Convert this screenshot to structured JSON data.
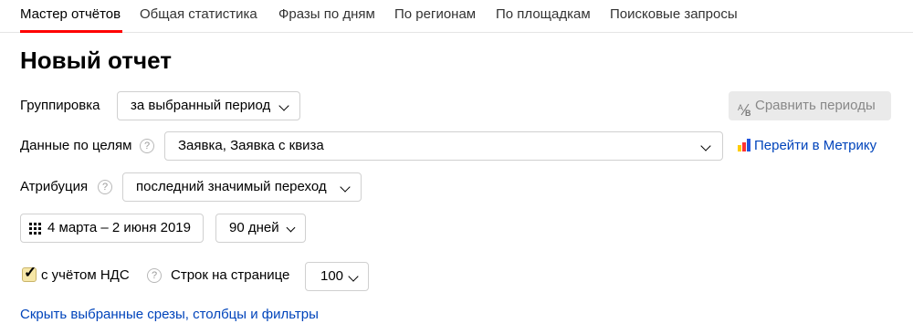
{
  "tabs": [
    {
      "label": "Мастер отчётов",
      "active": true
    },
    {
      "label": "Общая статистика"
    },
    {
      "label": "Фразы по дням"
    },
    {
      "label": "По регионам"
    },
    {
      "label": "По площадкам"
    },
    {
      "label": "Поисковые запросы"
    }
  ],
  "title": "Новый отчет",
  "grouping": {
    "label": "Группировка",
    "value": "за выбранный период"
  },
  "compare": {
    "label": "Сравнить периоды",
    "icon": "compare-icon",
    "disabled": true
  },
  "goals": {
    "label": "Данные по целям",
    "value": "Заявка, Заявка с квиза",
    "help": "?"
  },
  "metrika": {
    "label": "Перейти в Метрику",
    "icon": "metrika-icon",
    "colors": [
      "#ffcc00",
      "#ff3333",
      "#2255dd"
    ]
  },
  "attribution": {
    "label": "Атрибуция",
    "value": "последний значимый переход",
    "help": "?"
  },
  "date_range": {
    "value": "4 марта – 2 июня 2019",
    "icon": "calendar-icon"
  },
  "period": {
    "value": "90 дней"
  },
  "vat": {
    "label": "с учётом НДС",
    "checked": true,
    "help": "?"
  },
  "rows_per_page": {
    "label": "Строк на странице",
    "value": "100"
  },
  "hide_link": {
    "label": "Скрыть выбранные срезы, столбцы и фильтры"
  },
  "colors": {
    "accent": "#ff0000",
    "link": "#0044bb",
    "checkbox": "#f6e7a8"
  }
}
